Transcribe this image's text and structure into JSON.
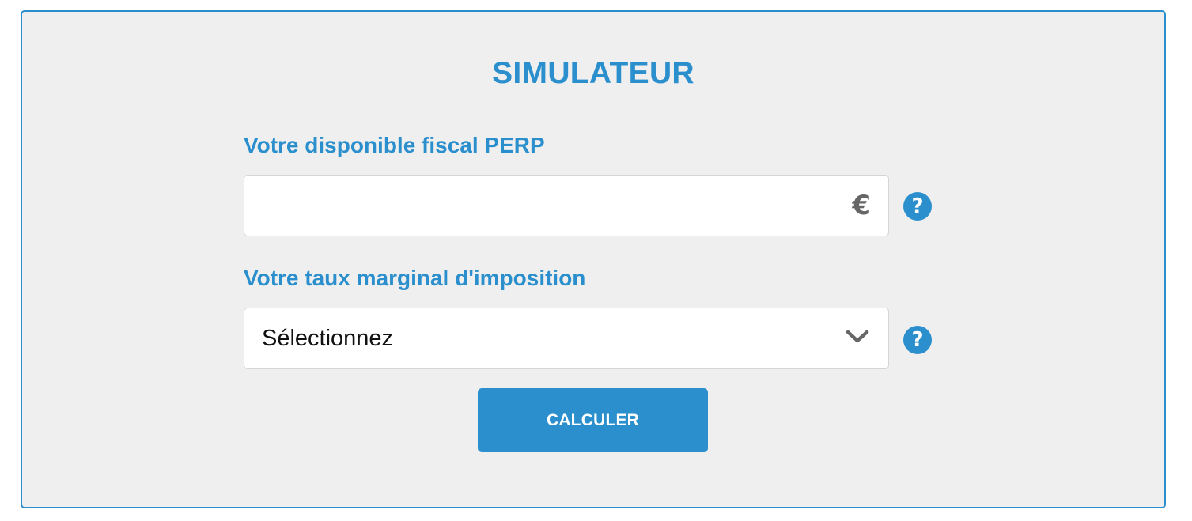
{
  "simulator": {
    "title": "SIMULATEUR",
    "fields": [
      {
        "label": "Votre disponible fiscal PERP",
        "value": "",
        "unit": "€",
        "help_icon": "question-circle-icon"
      },
      {
        "label": "Votre taux marginal d'imposition",
        "selected": "Sélectionnez",
        "dropdown_icon": "chevron-down-icon",
        "help_icon": "question-circle-icon"
      }
    ],
    "submit_label": "CALCULER",
    "help_glyph": "?"
  },
  "colors": {
    "accent": "#2a8fcc",
    "panel_background": "#efeff0",
    "field_background": "#ffffff",
    "unit_text": "#666666"
  }
}
